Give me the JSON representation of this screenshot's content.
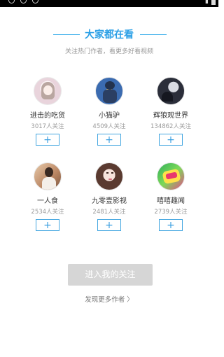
{
  "header": {
    "title": "大家都在看",
    "subtitle": "关注热门作者，看更多好看视频"
  },
  "authors": [
    {
      "name": "进击的吃货",
      "followers": "3017人关注",
      "follow_label": "+",
      "avatar_icon": "anime-girl-avatar",
      "avatar_color": "#f3e6ea"
    },
    {
      "name": "小猫驴",
      "followers": "4509人关注",
      "follow_label": "+",
      "avatar_icon": "character-figure-avatar",
      "avatar_color": "#3d6aa8"
    },
    {
      "name": "辉狼观世界",
      "followers": "134862人关注",
      "follow_label": "+",
      "avatar_icon": "wolf-night-avatar",
      "avatar_color": "#2b2e3a"
    },
    {
      "name": "一人食",
      "followers": "2534人关注",
      "follow_label": "+",
      "avatar_icon": "person-photo-avatar",
      "avatar_color": "#c89b7b"
    },
    {
      "name": "九零壹影视",
      "followers": "2481人关注",
      "follow_label": "+",
      "avatar_icon": "woman-portrait-avatar",
      "avatar_color": "#e8cfc6"
    },
    {
      "name": "嘻嘻趣闻",
      "followers": "2739人关注",
      "follow_label": "+",
      "avatar_icon": "cartoon-logo-avatar",
      "avatar_color": "#2fb05c"
    }
  ],
  "footer": {
    "enter_label": "进入我的关注",
    "discover_label": "发现更多作者 〉"
  },
  "colors": {
    "accent": "#2a9fe6",
    "button_disabled": "#d6d6d6"
  }
}
